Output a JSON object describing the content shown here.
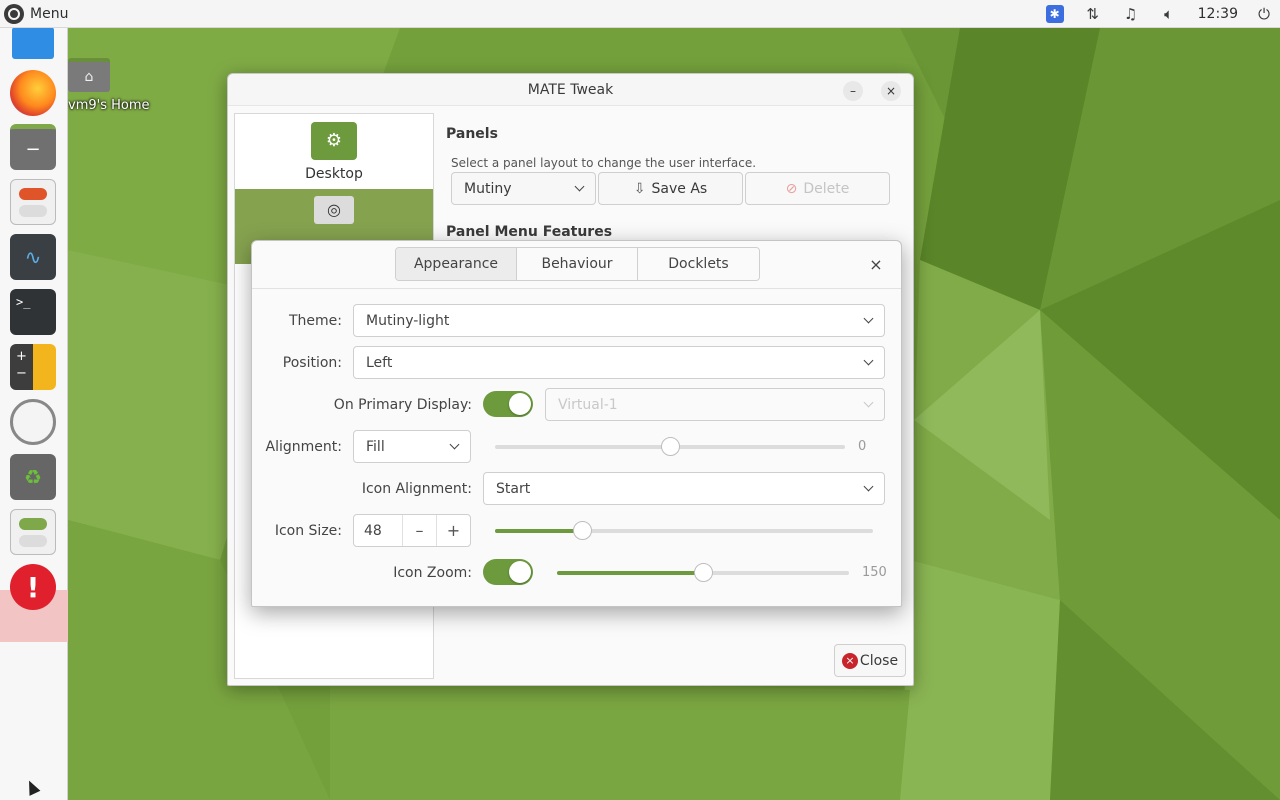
{
  "top_panel": {
    "menu_label": "Menu",
    "clock": "12:39",
    "tray_icons": [
      "accessibility-icon",
      "network-icon",
      "notification-bell-icon",
      "volume-icon",
      "power-icon"
    ]
  },
  "dock": {
    "items": [
      "file-manager-icon",
      "firefox-icon",
      "files-icon",
      "settings-toggle-icon",
      "system-monitor-icon",
      "terminal-icon",
      "calculator-icon",
      "clock-icon",
      "trash-icon",
      "tweak-toggle-icon",
      "error-alert-icon"
    ]
  },
  "desktop": {
    "home_label": "vm9's Home"
  },
  "tweak": {
    "title": "MATE Tweak",
    "minimize": "–",
    "close_glyph": "×",
    "sidebar": [
      {
        "label": "Desktop",
        "selected": false
      },
      {
        "label": "",
        "selected": true
      }
    ],
    "panels_heading": "Panels",
    "panels_hint": "Select a panel layout to change the user interface.",
    "layout_value": "Mutiny",
    "save_as_label": "Save As",
    "delete_label": "Delete",
    "menu_features_heading": "Panel Menu Features",
    "close_label": "Close"
  },
  "dialog": {
    "tabs": [
      "Appearance",
      "Behaviour",
      "Docklets"
    ],
    "active_tab": "Appearance",
    "close_glyph": "×",
    "theme_label": "Theme:",
    "theme_value": "Mutiny-light",
    "position_label": "Position:",
    "position_value": "Left",
    "primary_display_label": "On Primary Display:",
    "primary_display_on": true,
    "display_value": "Virtual-1",
    "alignment_label": "Alignment:",
    "alignment_value": "Fill",
    "alignment_slider_value": "0",
    "icon_alignment_label": "Icon Alignment:",
    "icon_alignment_value": "Start",
    "icon_size_label": "Icon Size:",
    "icon_size_value": "48",
    "icon_size_slider_fraction": 0.23,
    "icon_zoom_label": "Icon Zoom:",
    "icon_zoom_on": true,
    "icon_zoom_value": "150",
    "icon_zoom_fraction": 0.5,
    "minus_glyph": "–",
    "plus_glyph": "+"
  },
  "colors": {
    "accent_green": "#6c9a3c",
    "sidebar_selected": "#85a24f",
    "close_red": "#c8242c"
  }
}
